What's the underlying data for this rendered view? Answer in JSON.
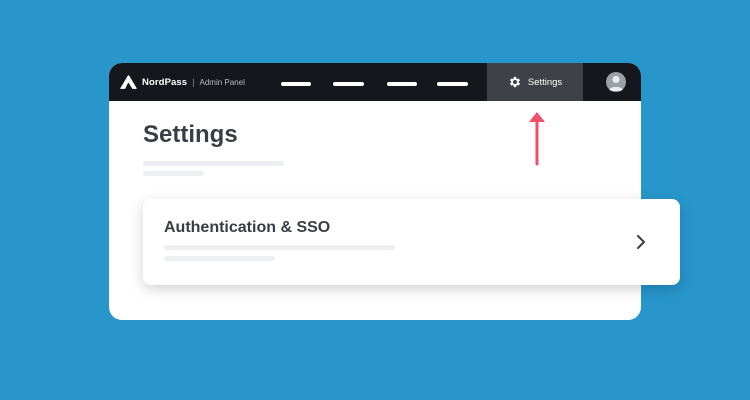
{
  "header": {
    "brand_name": "NordPass",
    "separator": "|",
    "brand_subtitle": "Admin Panel",
    "nav_items": [
      "",
      "",
      "",
      ""
    ],
    "settings_tab_label": "Settings",
    "settings_icon": "gear-icon",
    "avatar_icon": "user-avatar-icon"
  },
  "main": {
    "page_title": "Settings"
  },
  "card": {
    "title": "Authentication & SSO",
    "chevron_icon": "chevron-right-icon"
  },
  "annotation": {
    "arrow_icon": "arrow-up-icon",
    "arrow_color": "#f0506a"
  },
  "colors": {
    "background": "#2896cb",
    "topbar": "#15171c",
    "active_tab": "#3e4148"
  }
}
